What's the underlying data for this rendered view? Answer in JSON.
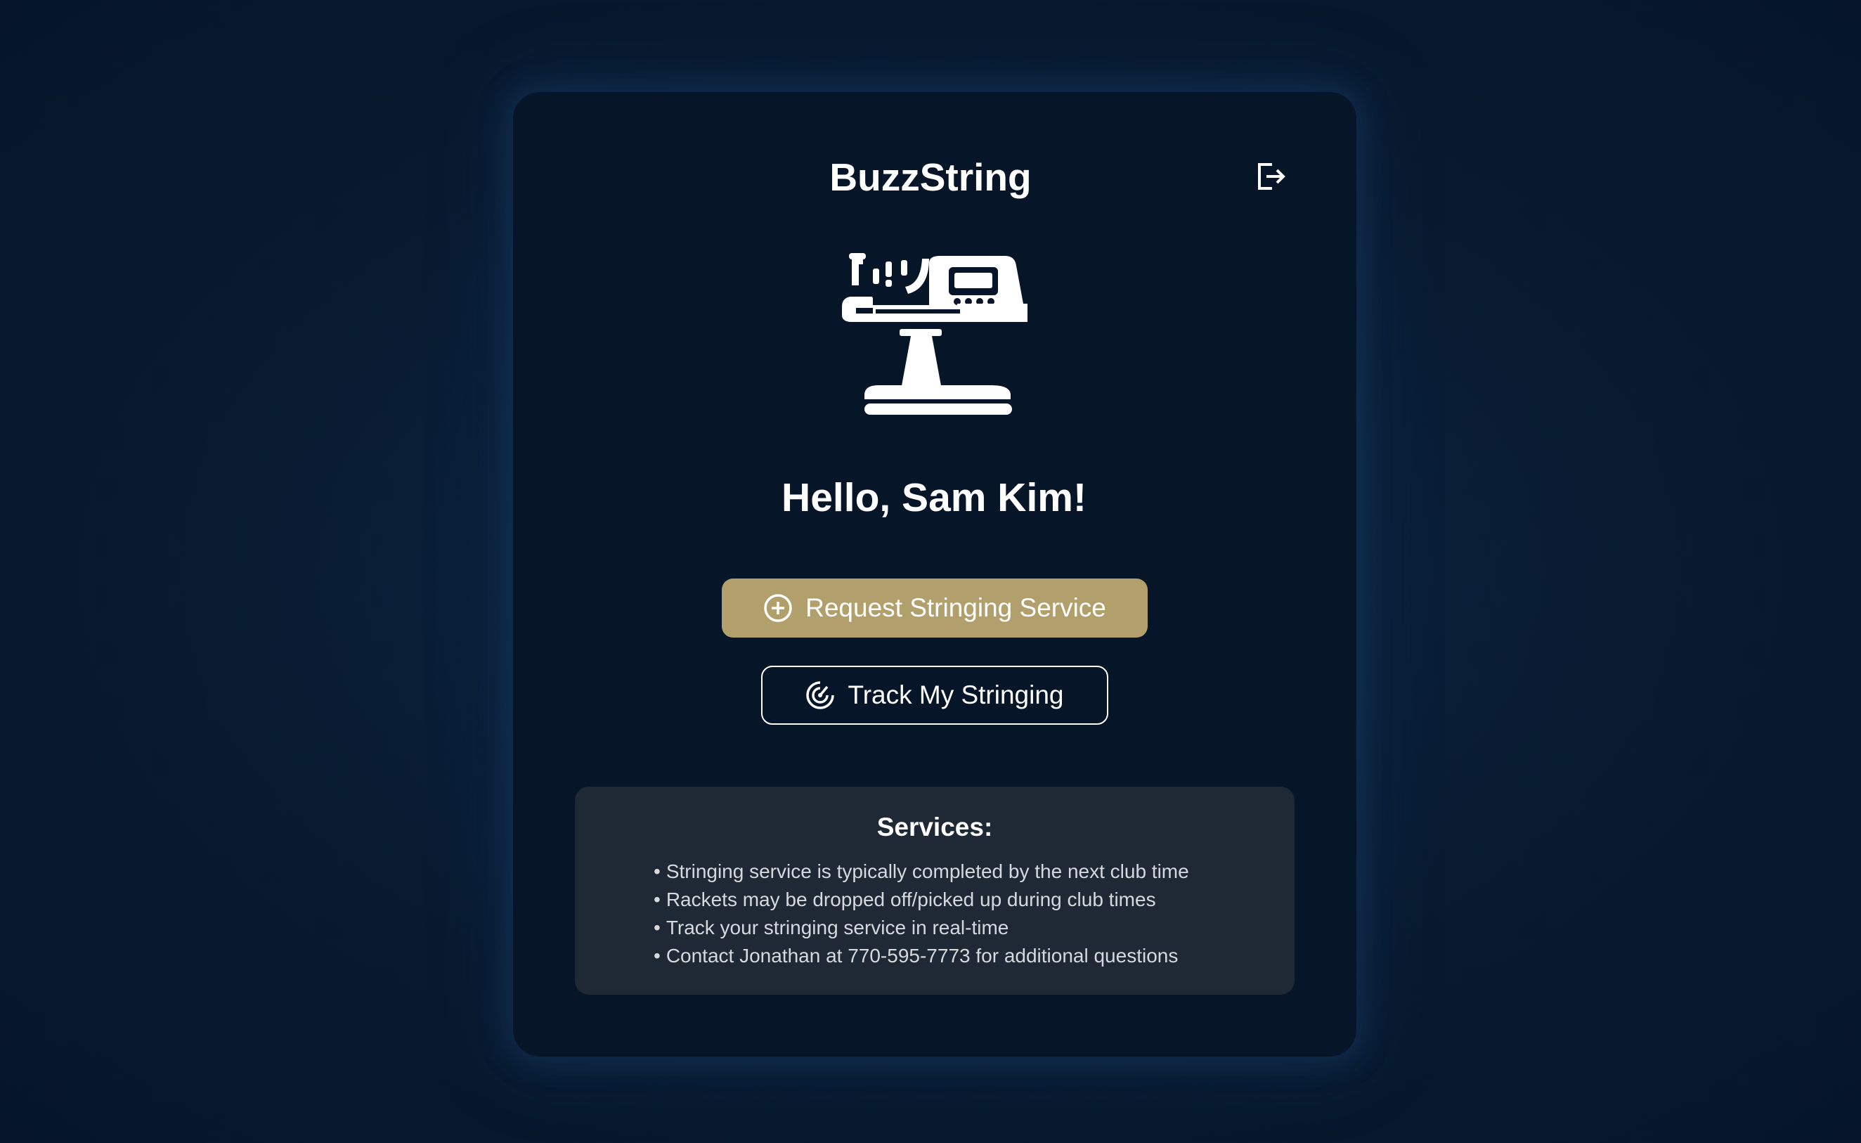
{
  "app": {
    "title": "BuzzString"
  },
  "header": {
    "logout_icon": "logout-icon"
  },
  "hero": {
    "icon": "stringing-machine-icon",
    "greeting": "Hello, Sam Kim!"
  },
  "actions": {
    "request_label": "Request Stringing Service",
    "request_icon": "plus-circle-icon",
    "track_label": "Track My Stringing",
    "track_icon": "radar-icon"
  },
  "services": {
    "title": "Services:",
    "items": [
      "Stringing service is typically completed by the next club time",
      "Rackets may be dropped off/picked up during club times",
      "Track your stringing service in real-time",
      "Contact Jonathan at 770-595-7773 for additional questions"
    ]
  },
  "colors": {
    "background": "#081a2f",
    "card": "#061527",
    "accent_gold": "#b1a06c",
    "services_panel": "#1f2935",
    "text_primary": "#ffffff",
    "text_secondary": "#d5d9de"
  }
}
